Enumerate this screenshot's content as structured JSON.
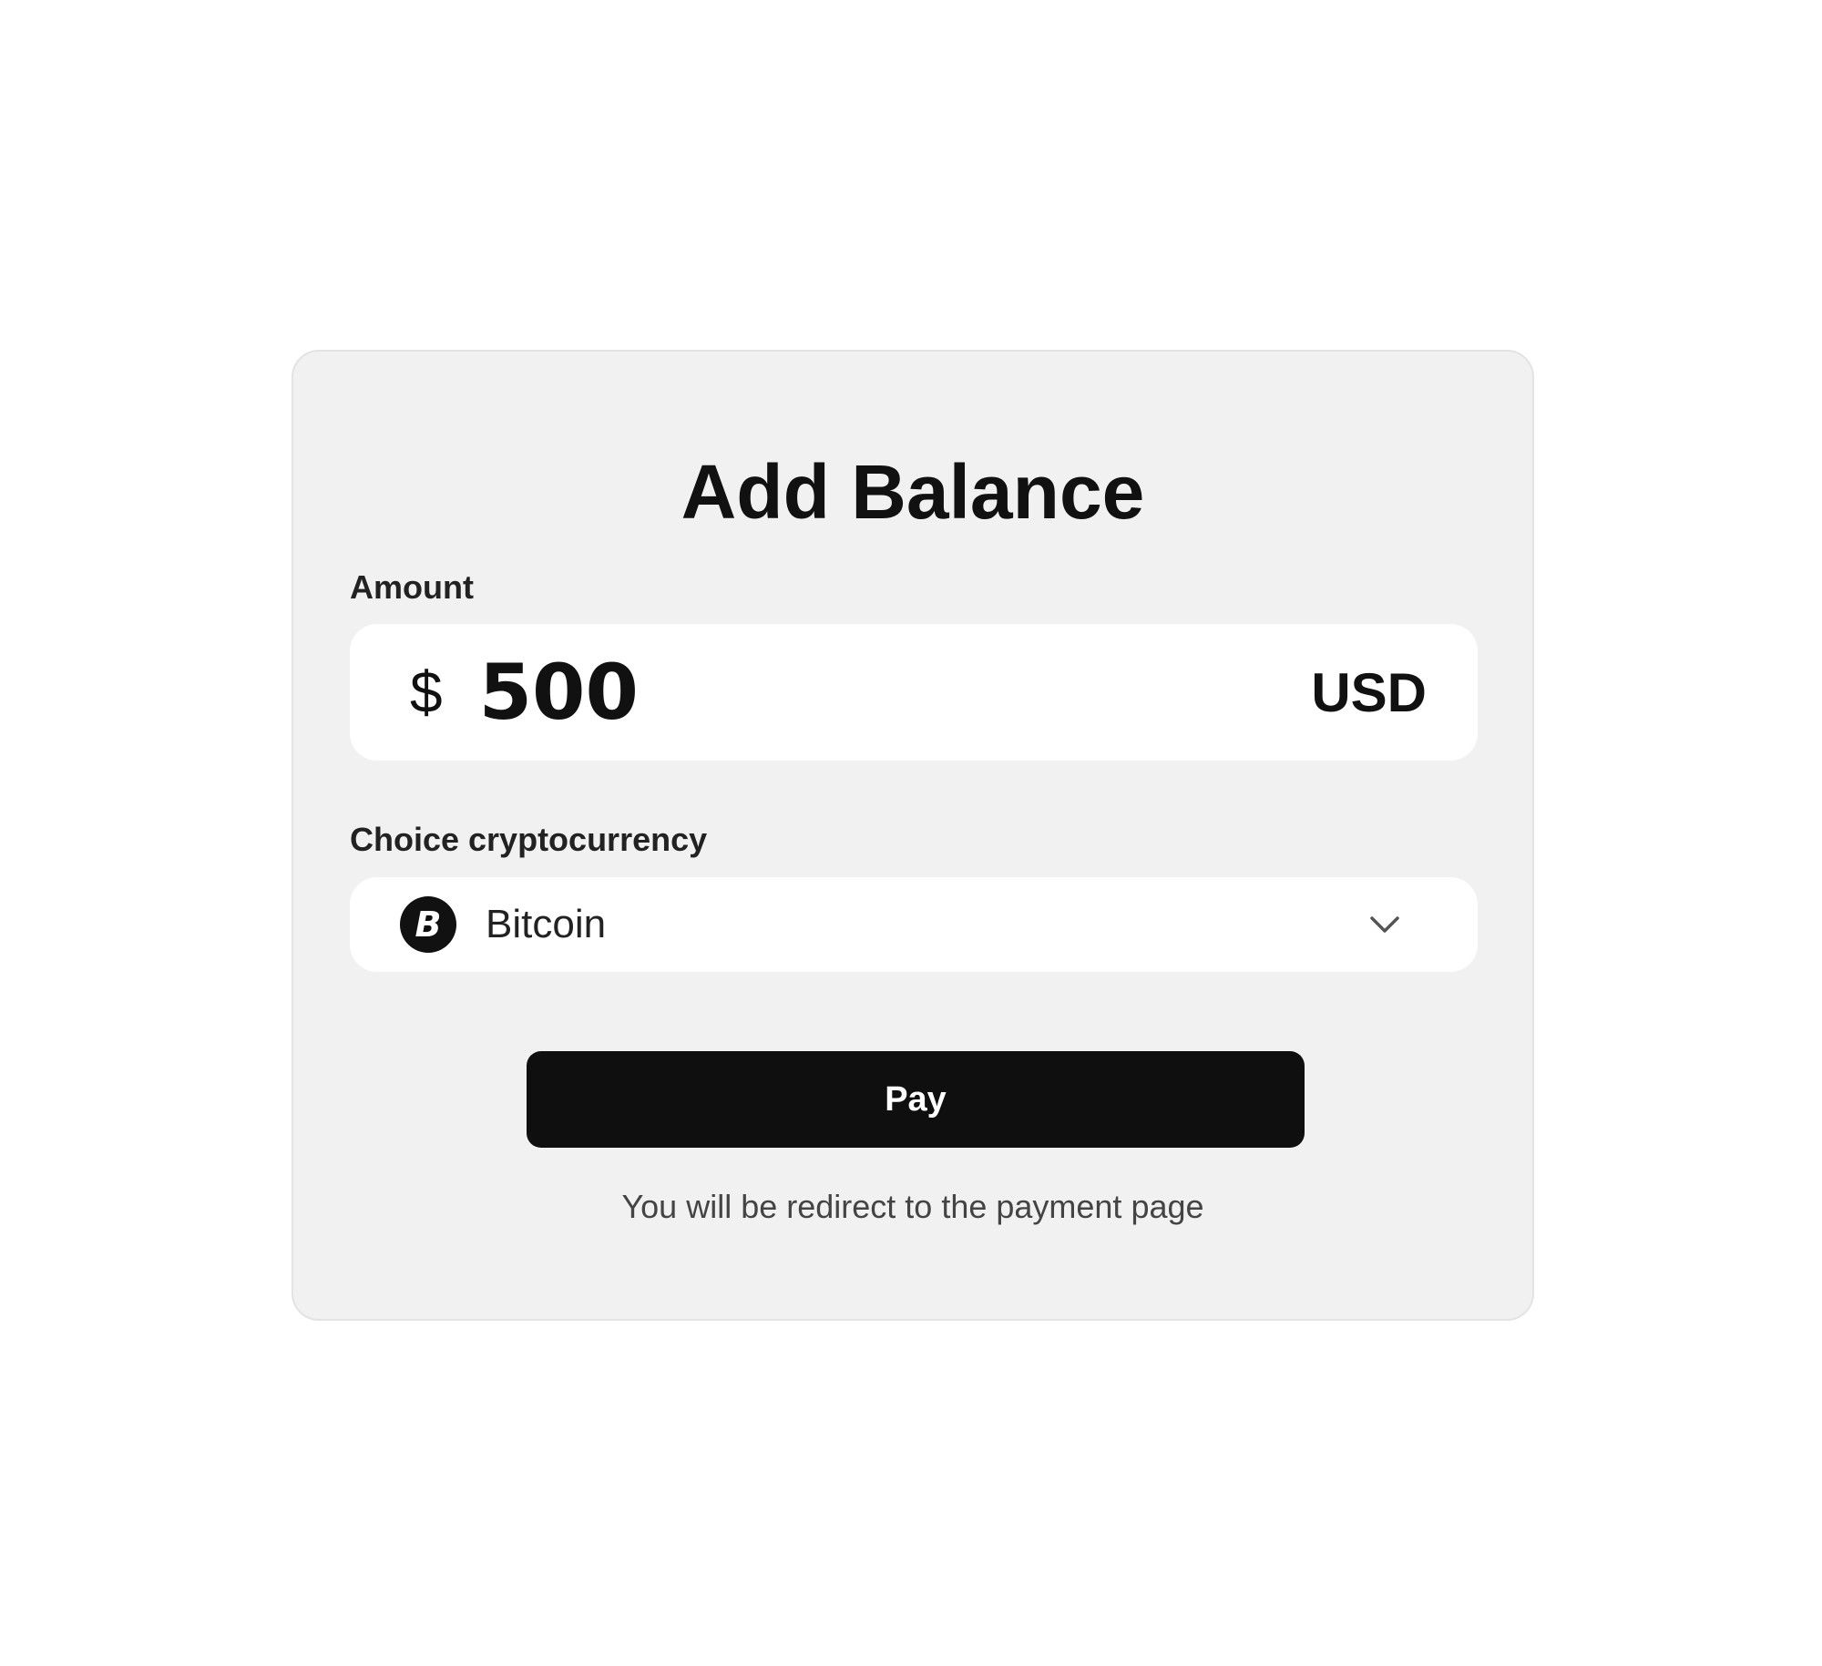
{
  "modal": {
    "title": "Add Balance",
    "amount_label": "Amount",
    "amount": {
      "symbol": "$",
      "value": "500",
      "currency": "USD"
    },
    "crypto_label": "Choice cryptocurrency",
    "crypto": {
      "selected": "Bitcoin",
      "icon": "bitcoin-icon",
      "icon_glyph": "B"
    },
    "pay_label": "Pay",
    "note": "You will be redirect to the payment page"
  }
}
